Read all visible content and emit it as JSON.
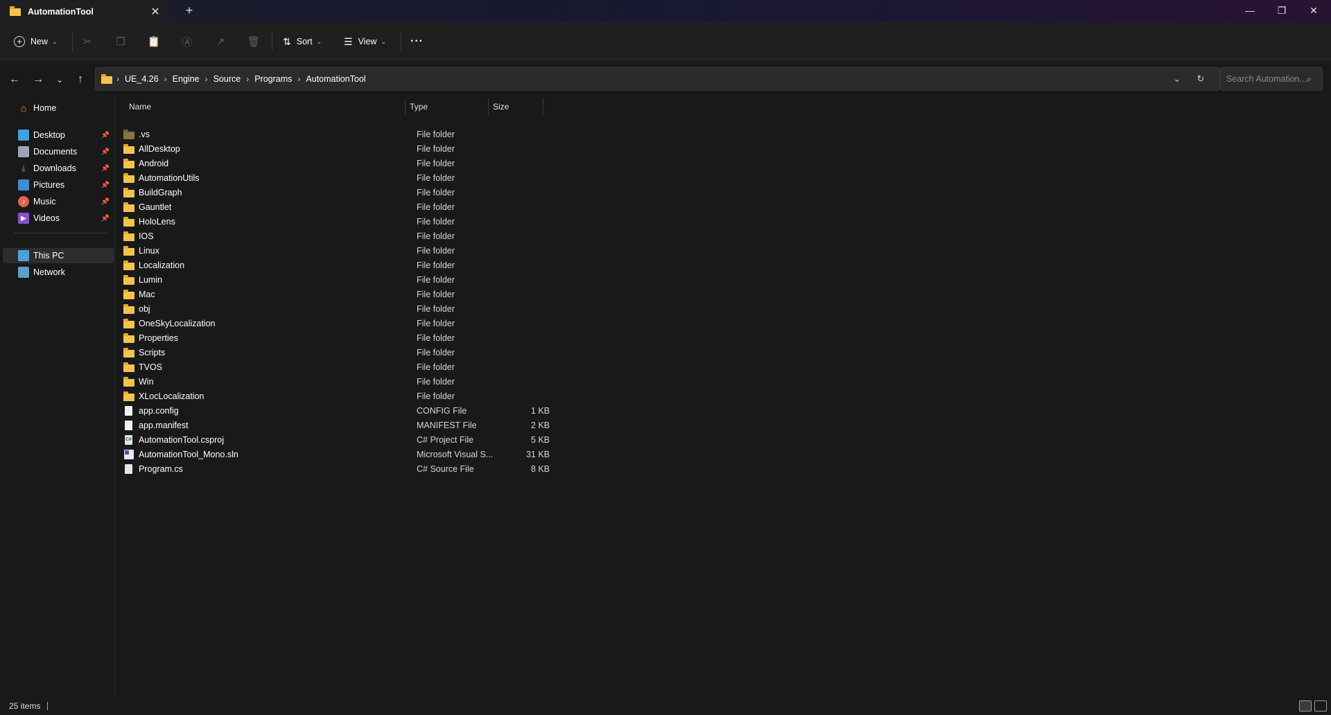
{
  "tab": {
    "title": "AutomationTool",
    "close": "✕",
    "new": "+"
  },
  "window": {
    "minimize": "—",
    "restore": "❐",
    "close": "✕"
  },
  "toolbar": {
    "new_label": "New",
    "sort_label": "Sort",
    "view_label": "View",
    "more_label": "···"
  },
  "address": {
    "crumbs": [
      "UE_4.26",
      "Engine",
      "Source",
      "Programs",
      "AutomationTool"
    ],
    "separator": "›"
  },
  "search": {
    "placeholder": "Search Automation..."
  },
  "sidebar": {
    "home": "Home",
    "pinned": [
      "Desktop",
      "Documents",
      "Downloads",
      "Pictures",
      "Music",
      "Videos"
    ],
    "this_pc": "This PC",
    "network": "Network"
  },
  "columns": {
    "name": "Name",
    "type": "Type",
    "size": "Size"
  },
  "files": [
    {
      "name": ".vs",
      "type": "File folder",
      "size": "",
      "kind": "folder-hidden"
    },
    {
      "name": "AllDesktop",
      "type": "File folder",
      "size": "",
      "kind": "folder"
    },
    {
      "name": "Android",
      "type": "File folder",
      "size": "",
      "kind": "folder"
    },
    {
      "name": "AutomationUtils",
      "type": "File folder",
      "size": "",
      "kind": "folder"
    },
    {
      "name": "BuildGraph",
      "type": "File folder",
      "size": "",
      "kind": "folder"
    },
    {
      "name": "Gauntlet",
      "type": "File folder",
      "size": "",
      "kind": "folder"
    },
    {
      "name": "HoloLens",
      "type": "File folder",
      "size": "",
      "kind": "folder"
    },
    {
      "name": "IOS",
      "type": "File folder",
      "size": "",
      "kind": "folder"
    },
    {
      "name": "Linux",
      "type": "File folder",
      "size": "",
      "kind": "folder"
    },
    {
      "name": "Localization",
      "type": "File folder",
      "size": "",
      "kind": "folder"
    },
    {
      "name": "Lumin",
      "type": "File folder",
      "size": "",
      "kind": "folder"
    },
    {
      "name": "Mac",
      "type": "File folder",
      "size": "",
      "kind": "folder"
    },
    {
      "name": "obj",
      "type": "File folder",
      "size": "",
      "kind": "folder"
    },
    {
      "name": "OneSkyLocalization",
      "type": "File folder",
      "size": "",
      "kind": "folder"
    },
    {
      "name": "Properties",
      "type": "File folder",
      "size": "",
      "kind": "folder"
    },
    {
      "name": "Scripts",
      "type": "File folder",
      "size": "",
      "kind": "folder"
    },
    {
      "name": "TVOS",
      "type": "File folder",
      "size": "",
      "kind": "folder"
    },
    {
      "name": "Win",
      "type": "File folder",
      "size": "",
      "kind": "folder"
    },
    {
      "name": "XLocLocalization",
      "type": "File folder",
      "size": "",
      "kind": "folder"
    },
    {
      "name": "app.config",
      "type": "CONFIG File",
      "size": "1 KB",
      "kind": "file"
    },
    {
      "name": "app.manifest",
      "type": "MANIFEST File",
      "size": "2 KB",
      "kind": "file"
    },
    {
      "name": "AutomationTool.csproj",
      "type": "C# Project File",
      "size": "5 KB",
      "kind": "csproj"
    },
    {
      "name": "AutomationTool_Mono.sln",
      "type": "Microsoft Visual S...",
      "size": "31 KB",
      "kind": "sln"
    },
    {
      "name": "Program.cs",
      "type": "C# Source File",
      "size": "8 KB",
      "kind": "cs"
    }
  ],
  "status": {
    "item_count": "25 items"
  }
}
